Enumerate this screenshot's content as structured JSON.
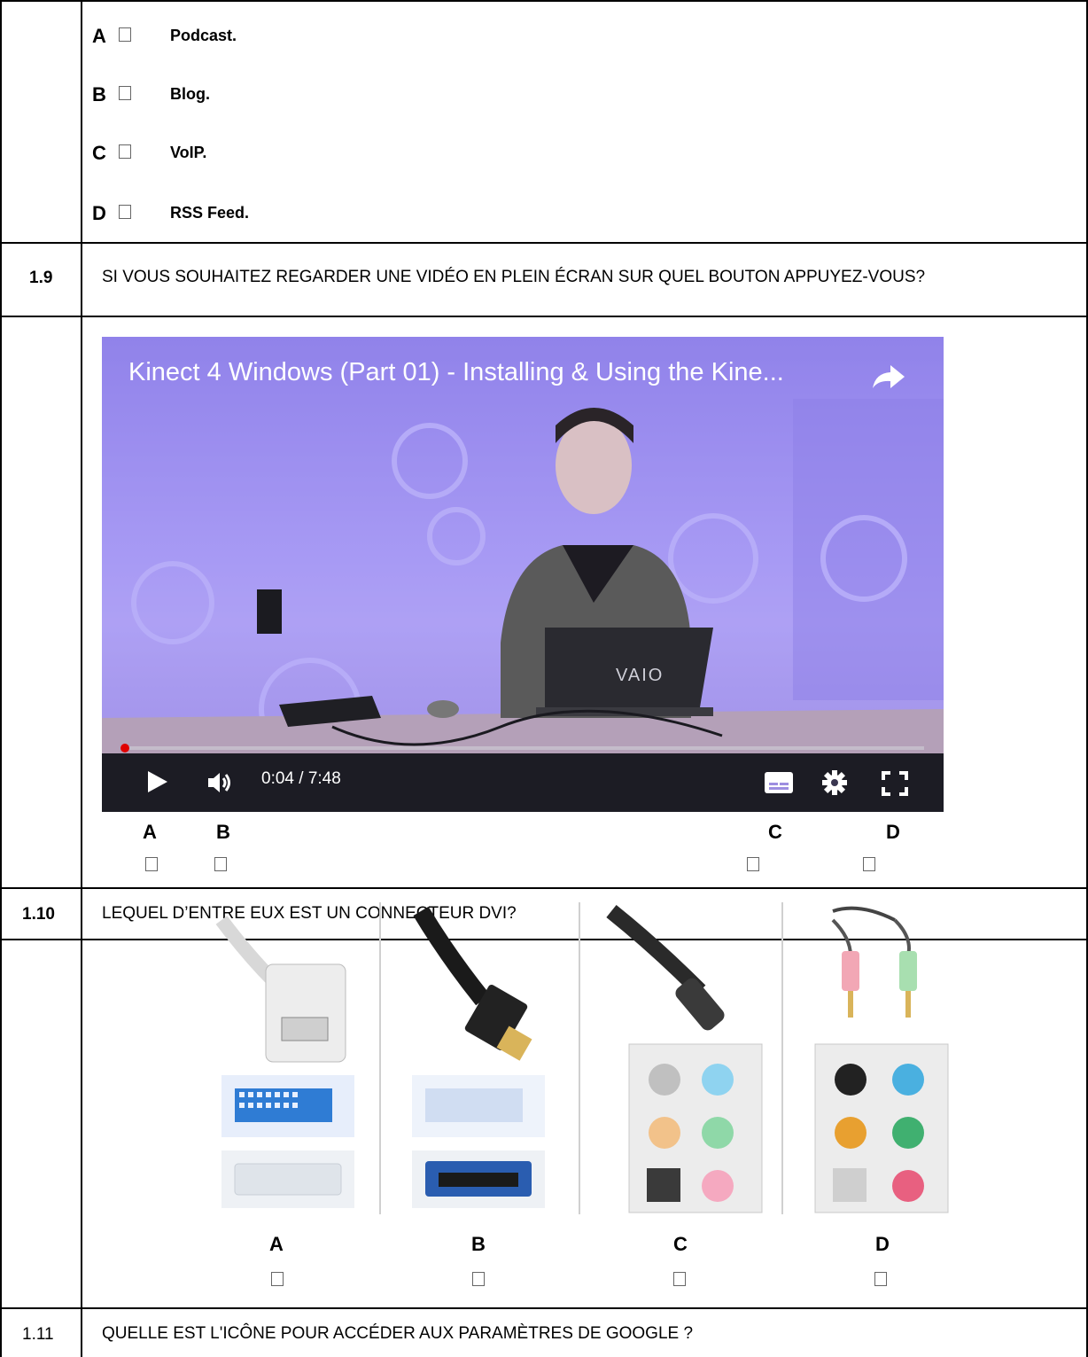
{
  "question_1_8": {
    "options": [
      {
        "letter": "A",
        "label": "Podcast."
      },
      {
        "letter": "B",
        "label": "Blog."
      },
      {
        "letter": "C",
        "label": "VoIP."
      },
      {
        "letter": "D",
        "label": "RSS Feed."
      }
    ]
  },
  "question_1_9": {
    "number": "1.9",
    "text": "SI VOUS SOUHAITEZ REGARDER UNE VIDÉO EN PLEIN ÉCRAN SUR QUEL BOUTON APPUYEZ-VOUS?",
    "video": {
      "title": "Kinect 4 Windows (Part 01) - Installing & Using the Kine...",
      "time": "0:04 / 7:48",
      "laptop_brand": "VAIO",
      "progress": 0.009
    },
    "option_letters": [
      "A",
      "B",
      "C",
      "D"
    ]
  },
  "question_1_10": {
    "number": "1.10",
    "text": "LEQUEL D’ENTRE EUX EST UN CONNECTEUR DVI?",
    "option_letters": [
      "A",
      "B",
      "C",
      "D"
    ]
  },
  "question_1_11": {
    "number": "1.11",
    "text": "QUELLE EST L'ICÔNE POUR ACCÉDER AUX PARAMÈTRES DE GOOGLE ?"
  },
  "colors": {
    "video_bg": "#9d8ee8",
    "progress_red": "#e00000"
  }
}
